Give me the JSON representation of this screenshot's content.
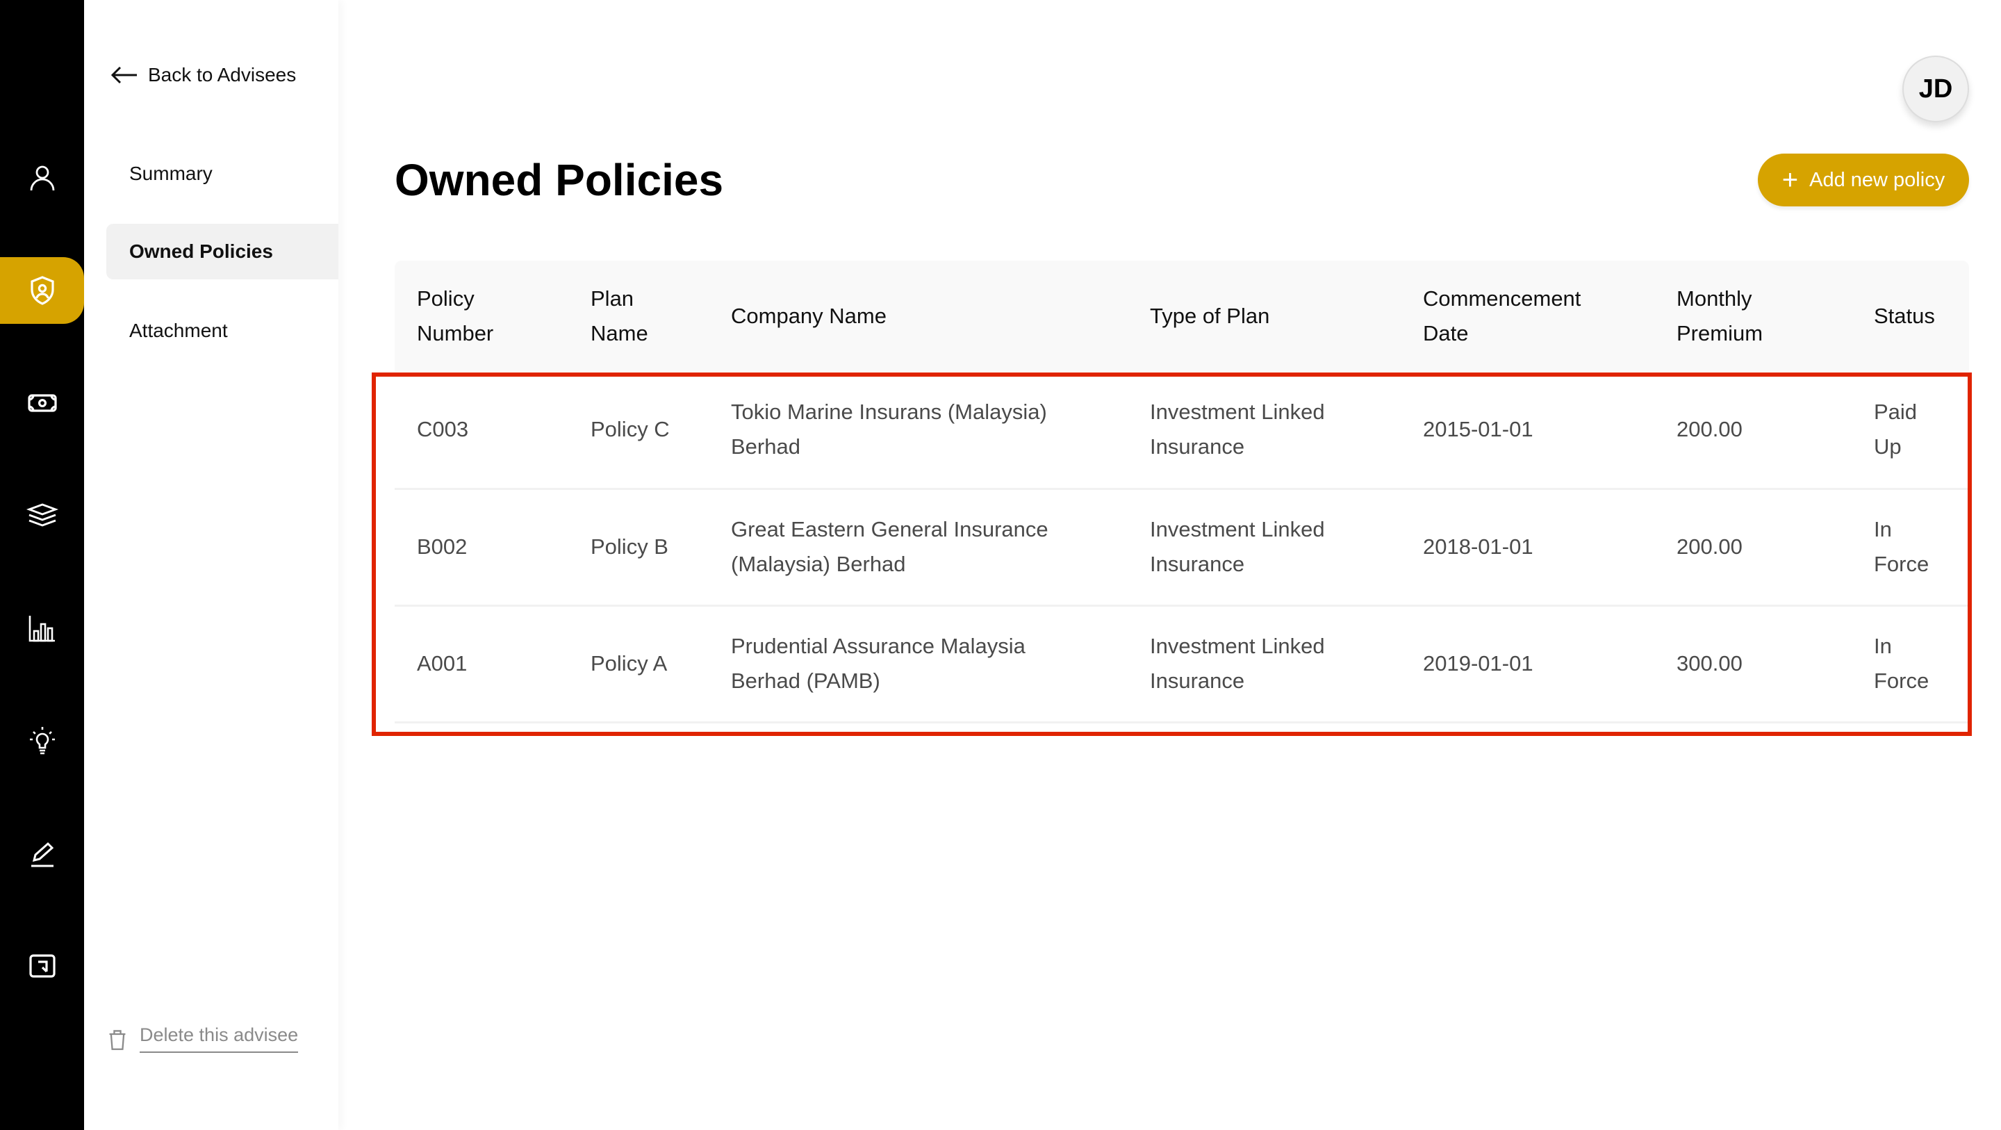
{
  "rail": {
    "items": [
      {
        "icon": "person-icon",
        "active": false
      },
      {
        "icon": "shield-person-icon",
        "active": true
      },
      {
        "icon": "money-icon",
        "active": false
      },
      {
        "icon": "layers-icon",
        "active": false
      },
      {
        "icon": "bar-chart-icon",
        "active": false
      },
      {
        "icon": "lightbulb-icon",
        "active": false
      },
      {
        "icon": "pen-icon",
        "active": false
      },
      {
        "icon": "logout-icon",
        "active": false
      }
    ],
    "accent_color": "#D6A300"
  },
  "subnav": {
    "back_label": "Back to Advisees",
    "items": [
      {
        "label": "Summary",
        "active": false
      },
      {
        "label": "Owned Policies",
        "active": true
      },
      {
        "label": "Attachment",
        "active": false
      }
    ],
    "delete_label": "Delete this advisee"
  },
  "header": {
    "avatar_initials": "JD",
    "title": "Owned Policies",
    "add_button_label": "Add new policy"
  },
  "table": {
    "columns": [
      "Policy Number",
      "Plan Name",
      "Company Name",
      "Type of Plan",
      "Commencement Date",
      "Monthly Premium",
      "Status"
    ],
    "rows": [
      {
        "policy_number": "C003",
        "plan_name": "Policy C",
        "company_name": "Tokio Marine Insurans (Malaysia) Berhad",
        "type_of_plan": "Investment Linked Insurance",
        "commencement_date": "2015-01-01",
        "monthly_premium": "200.00",
        "status": "Paid Up"
      },
      {
        "policy_number": "B002",
        "plan_name": "Policy B",
        "company_name": "Great Eastern General Insurance (Malaysia) Berhad",
        "type_of_plan": "Investment Linked Insurance",
        "commencement_date": "2018-01-01",
        "monthly_premium": "200.00",
        "status": "In Force"
      },
      {
        "policy_number": "A001",
        "plan_name": "Policy A",
        "company_name": "Prudential Assurance Malaysia Berhad (PAMB)",
        "type_of_plan": "Investment Linked Insurance",
        "commencement_date": "2019-01-01",
        "monthly_premium": "300.00",
        "status": "In Force"
      }
    ]
  },
  "annotation": {
    "highlight_color": "#E02400"
  }
}
